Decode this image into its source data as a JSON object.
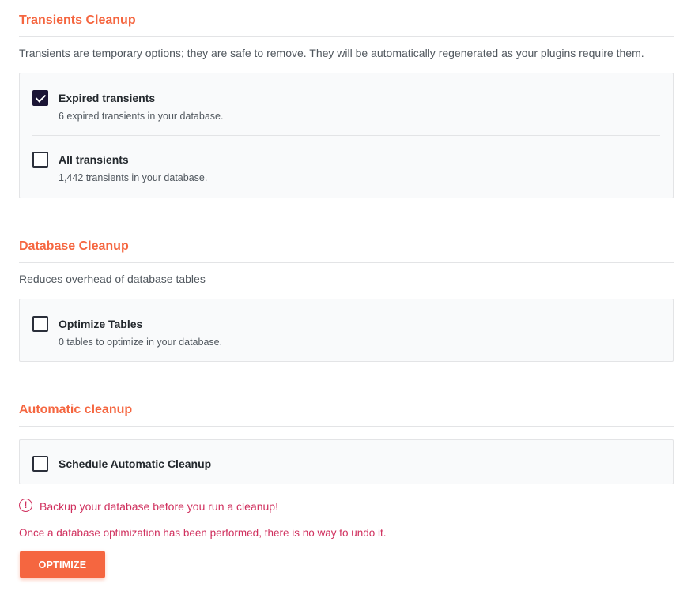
{
  "colors": {
    "accent": "#f56640",
    "warning": "#d0305e",
    "checkbox_checked": "#1b1535"
  },
  "transients": {
    "title": "Transients Cleanup",
    "description": "Transients are temporary options; they are safe to remove. They will be automatically regenerated as your plugins require them.",
    "options": [
      {
        "label": "Expired transients",
        "sub": "6 expired transients in your database.",
        "checked": true
      },
      {
        "label": "All transients",
        "sub": "1,442 transients in your database.",
        "checked": false
      }
    ]
  },
  "database": {
    "title": "Database Cleanup",
    "description": "Reduces overhead of database tables",
    "options": [
      {
        "label": "Optimize Tables",
        "sub": "0 tables to optimize in your database.",
        "checked": false
      }
    ]
  },
  "automatic": {
    "title": "Automatic cleanup",
    "options": [
      {
        "label": "Schedule Automatic Cleanup",
        "checked": false
      }
    ]
  },
  "warning": {
    "icon": "!",
    "text": "Backup your database before you run a cleanup!",
    "note": "Once a database optimization has been performed, there is no way to undo it."
  },
  "button": {
    "label": "OPTIMIZE"
  }
}
